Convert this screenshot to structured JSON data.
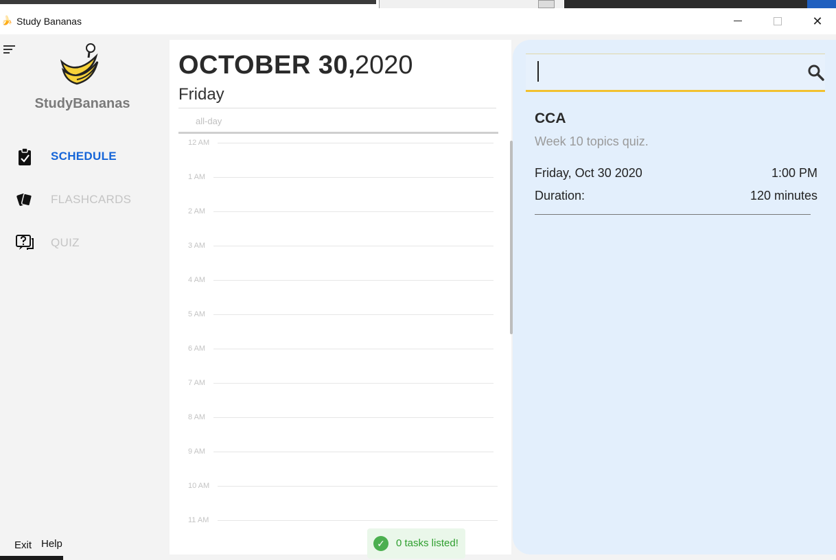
{
  "window": {
    "title": "Study Bananas",
    "minimize_icon": "minimize-icon",
    "maximize_icon": "maximize-icon",
    "close_icon": "close-icon",
    "close_glyph": "✕"
  },
  "sidebar": {
    "brand": "StudyBananas",
    "items": [
      {
        "label": "SCHEDULE",
        "icon": "clipboard-check-icon",
        "active": true
      },
      {
        "label": "FLASHCARDS",
        "icon": "cards-icon",
        "active": false
      },
      {
        "label": "QUIZ",
        "icon": "quiz-icon",
        "active": false
      }
    ],
    "menu": {
      "exit": "Exit",
      "help": "Help"
    }
  },
  "calendar": {
    "month_day": "OCTOBER 30,",
    "year": "2020",
    "weekday": "Friday",
    "all_day_label": "all-day",
    "hours": [
      "12 AM",
      "1 AM",
      "2 AM",
      "3 AM",
      "4 AM",
      "5 AM",
      "6 AM",
      "7 AM",
      "8 AM",
      "9 AM",
      "10 AM",
      "11 AM"
    ]
  },
  "status": {
    "message": "0 tasks listed!",
    "icon": "check-circle-icon",
    "color": "#2e9e2e"
  },
  "search": {
    "value": "",
    "icon": "search-icon",
    "accent": "#f2c12e"
  },
  "task": {
    "title": "CCA",
    "description": "Week 10 topics quiz.",
    "date": "Friday, Oct 30 2020",
    "time": "1:00 PM",
    "duration_label": "Duration:",
    "duration_value": "120 minutes"
  },
  "colors": {
    "accent_blue": "#1565d8",
    "panel_bg": "#e3effc"
  }
}
